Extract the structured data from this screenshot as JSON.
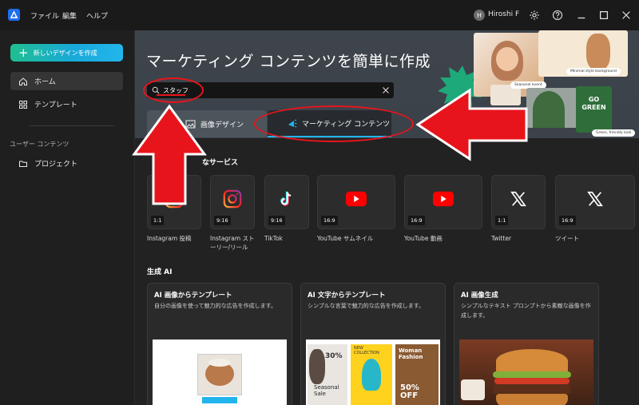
{
  "titlebar": {
    "menu": [
      "ファイル",
      "編集",
      "ヘルプ"
    ],
    "user_initial": "H",
    "user_name": "Hiroshi F",
    "icons": [
      "gear-icon",
      "help-icon",
      "minimize-icon",
      "maximize-icon",
      "close-icon"
    ]
  },
  "sidebar": {
    "new_design_label": "新しいデザインを作成",
    "items": [
      {
        "label": "ホーム",
        "icon": "home-icon",
        "active": true
      },
      {
        "label": "テンプレート",
        "icon": "template-icon",
        "active": false
      }
    ],
    "section_label": "ユーザー コンテンツ",
    "project_label": "プロジェクト"
  },
  "banner": {
    "title": "マーケティング コンテンツを簡単に作成",
    "search_value": "スタッフ",
    "tabs": [
      {
        "label": "画像デザイン",
        "active": false
      },
      {
        "label": "マーケティング コンテンツ",
        "active": true
      }
    ],
    "collage_labels": [
      "Minimal style background",
      "Seasonal event",
      "Green, friendly look"
    ],
    "collage_text": "GO GREEN"
  },
  "services": {
    "title_fragment": "なサービス",
    "items": [
      {
        "ratio": "1:1",
        "label": "Instagram 投稿",
        "icon": "instagram-icon"
      },
      {
        "ratio": "9:16",
        "label": "Instagram ストーリー/リール",
        "icon": "instagram-icon"
      },
      {
        "ratio": "9:16",
        "label": "TikTok",
        "icon": "tiktok-icon"
      },
      {
        "ratio": "16:9",
        "label": "YouTube サムネイル",
        "icon": "youtube-icon"
      },
      {
        "ratio": "16:9",
        "label": "YouTube 動画",
        "icon": "youtube-icon"
      },
      {
        "ratio": "1:1",
        "label": "Twitter",
        "icon": "x-icon"
      },
      {
        "ratio": "16:9",
        "label": "ツイート",
        "icon": "x-icon"
      }
    ]
  },
  "ai": {
    "title": "生成 AI",
    "cards": [
      {
        "title": "AI 画像からテンプレート",
        "desc": "自分の画像を使って魅力的な広告を作成します。"
      },
      {
        "title": "AI 文字からテンプレート",
        "desc": "シンプルな言葉で魅力的な広告を作成します。"
      },
      {
        "title": "AI 画像生成",
        "desc": "シンプルなテキスト プロンプトから素敵な画像を作成します。"
      }
    ],
    "preview_texts": [
      "30%",
      "NEW COLLECTION",
      "Woman Fashion",
      "Seasonal Sale",
      "50% OFF"
    ]
  },
  "colors": {
    "accent": "#22b4ec",
    "annotation_red": "#e8141c",
    "youtube_red": "#ff0000"
  }
}
